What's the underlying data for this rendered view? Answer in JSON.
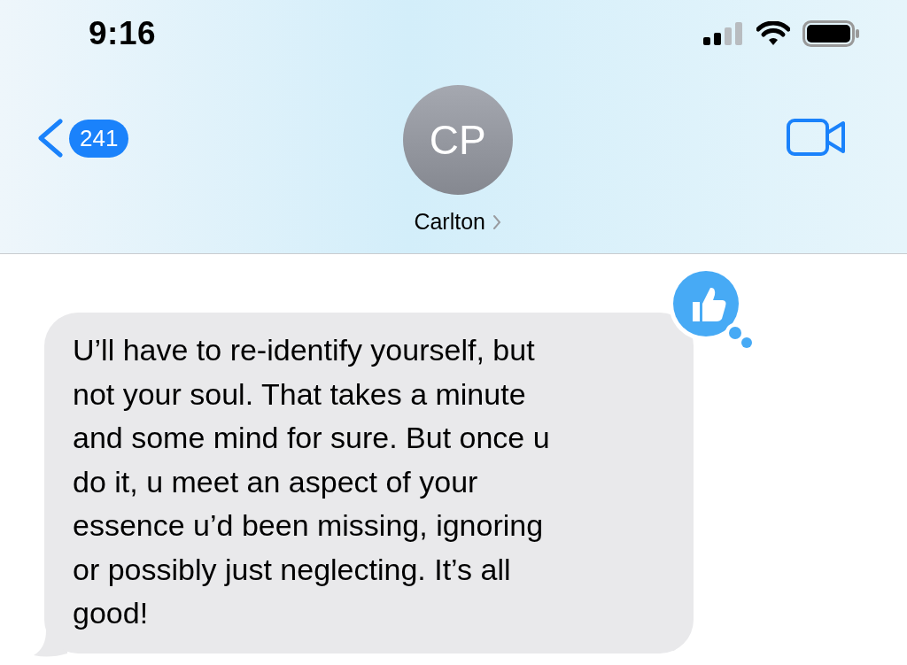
{
  "status_bar": {
    "time": "9:16"
  },
  "header": {
    "back_badge": "241",
    "avatar_initials": "CP",
    "contact_name": "Carlton"
  },
  "message": {
    "lines": [
      "U’ll have to re-identify yourself, but",
      "not your soul. That takes a minute",
      "and some mind for sure. But once u",
      "do it, u meet an aspect of your",
      "essence u’d been missing, ignoring",
      "or possibly just neglecting. It’s all",
      "good!"
    ],
    "reaction": {
      "kind": "thumbs-up"
    }
  }
}
